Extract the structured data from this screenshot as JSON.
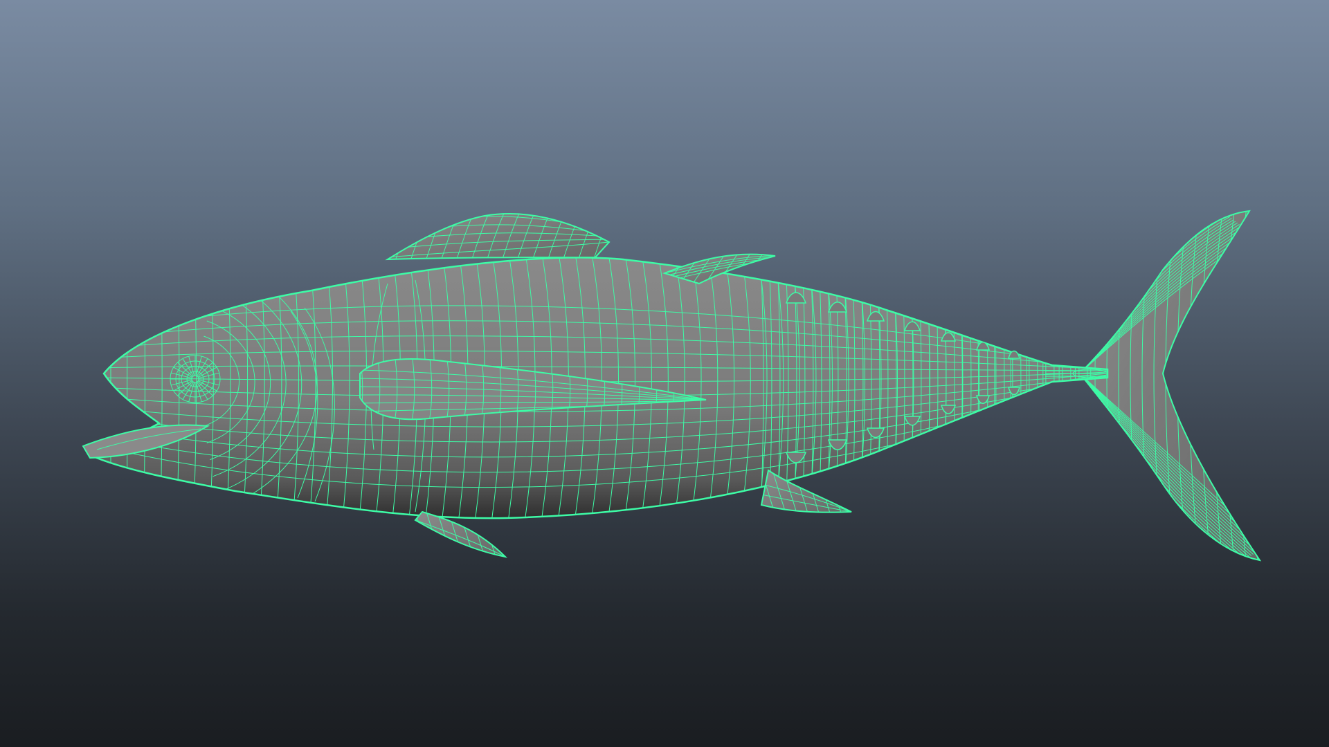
{
  "viewport": {
    "background_top": "#7a8ba2",
    "background_bottom": "#1a1d21"
  },
  "model": {
    "subject": "tuna-fish",
    "display_mode": "wireframe-on-shaded",
    "wire_color": "#3dfca6",
    "surface_color": "#7c7c7c",
    "selected": true
  }
}
